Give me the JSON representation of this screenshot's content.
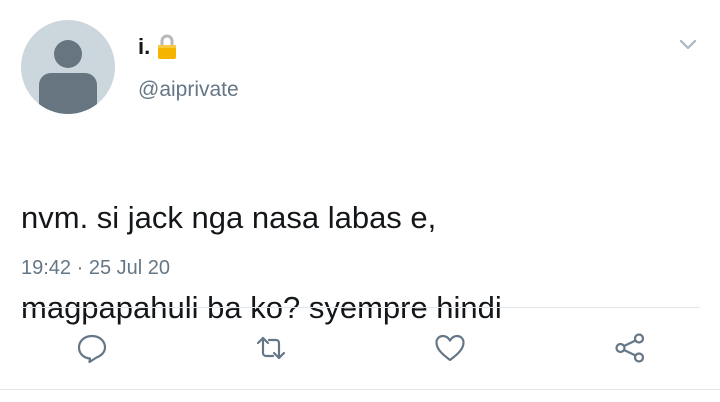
{
  "tweet": {
    "display_name": "i.",
    "handle": "@aiprivate",
    "text_line1": "nvm. si jack nga nasa labas e,",
    "text_line2": "magpapahuli ba ko? syempre hindi",
    "time": "19:42",
    "separator": "·",
    "date": "25 Jul 20"
  },
  "icons": {
    "avatar": "default-avatar",
    "lock": "lock-icon",
    "menu": "chevron-down-icon",
    "reply": "reply-icon",
    "retweet": "retweet-icon",
    "like": "heart-icon",
    "share": "share-icon"
  },
  "colors": {
    "text": "#14171a",
    "secondary": "#657786",
    "icon": "#657786",
    "lock": "#f5b400",
    "divider": "#e1e8ed",
    "avatar_bg": "#ccd6dd",
    "avatar_fg": "#66757f"
  }
}
